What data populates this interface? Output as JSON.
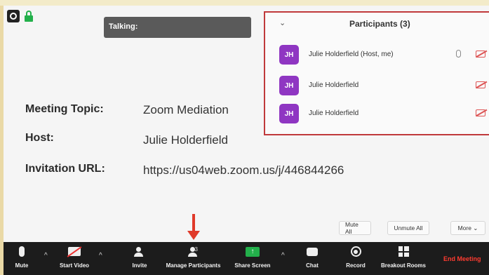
{
  "talking_banner": "Talking:",
  "participants_panel": {
    "title": "Participants (3)",
    "items": [
      {
        "initials": "JH",
        "name": "Julie Holderfield (Host, me)",
        "mic": true
      },
      {
        "initials": "JH",
        "name": "Julie Holderfield",
        "mic": false
      },
      {
        "initials": "JH",
        "name": "Julie Holderfield",
        "mic": false
      }
    ],
    "avatar_color": "#8f36c2"
  },
  "meeting_info": {
    "topic_label": "Meeting Topic:",
    "topic_value": "Zoom Mediation",
    "host_label": "Host:",
    "host_value": "Julie Holderfield",
    "url_label": "Invitation URL:",
    "url_value": "https://us04web.zoom.us/j/446844266"
  },
  "panel_buttons": {
    "mute_all": "Mute All",
    "unmute_all": "Unmute All",
    "more": "More ⌄"
  },
  "toolbar": {
    "mute": "Mute",
    "start_video": "Start Video",
    "invite": "Invite",
    "manage_participants": "Manage Participants",
    "participant_count": "3",
    "share_screen": "Share Screen",
    "chat": "Chat",
    "record": "Record",
    "breakout_rooms": "Breakout Rooms",
    "end_meeting": "End Meeting"
  },
  "colors": {
    "highlight_border": "#c0393b",
    "arrow": "#e03a2a",
    "share_green": "#23b04b",
    "end_red": "#ff3b30"
  }
}
